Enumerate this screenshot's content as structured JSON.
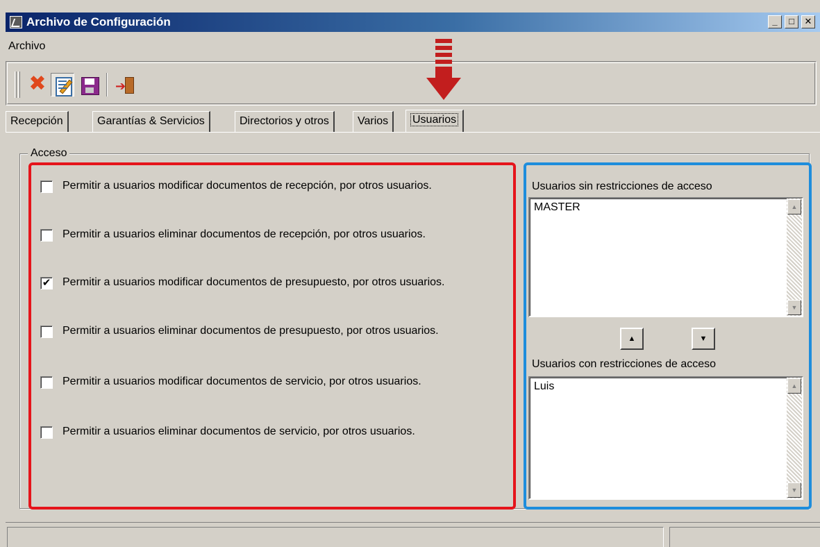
{
  "window": {
    "title": "Archivo de Configuración",
    "title_buttons": [
      "_",
      "□",
      "✕"
    ]
  },
  "menu": {
    "items": [
      "Archivo"
    ]
  },
  "toolbar": {
    "icons": [
      "delete-icon",
      "edit-icon",
      "save-icon",
      "exit-icon"
    ]
  },
  "tabs": [
    "Recepción",
    "Garantías & Servicios",
    "Directorios y otros",
    "Varios",
    "Usuarios"
  ],
  "active_tab": "Usuarios",
  "group": {
    "legend": "Acceso",
    "options": [
      {
        "label": "Permitir a usuarios modificar documentos de recepción, por otros usuarios.",
        "checked": false,
        "mark": ""
      },
      {
        "label": "Permitir a usuarios eliminar documentos de recepción, por otros usuarios.",
        "checked": false,
        "mark": ""
      },
      {
        "label": "Permitir a usuarios modificar documentos de presupuesto, por otros usuarios.",
        "checked": true,
        "mark": "✔"
      },
      {
        "label": "Permitir a usuarios eliminar documentos de presupuesto, por otros usuarios.",
        "checked": false,
        "mark": ""
      },
      {
        "label": "Permitir a usuarios modificar documentos de servicio, por otros usuarios.",
        "checked": false,
        "mark": ""
      },
      {
        "label": "Permitir a usuarios eliminar documentos de servicio, por otros usuarios.",
        "checked": false,
        "mark": ""
      }
    ]
  },
  "lists": {
    "unrestricted": {
      "label": "Usuarios sin restricciones de acceso",
      "items": [
        "MASTER"
      ]
    },
    "restricted": {
      "label": "Usuarios con restricciones de acceso",
      "items": [
        "Luis"
      ]
    },
    "move_up": "▲",
    "move_down": "▼"
  },
  "annotation_colors": {
    "red_frame": "#e5141b",
    "blue_frame": "#1e8ddc",
    "arrow": "#c21e1e"
  }
}
